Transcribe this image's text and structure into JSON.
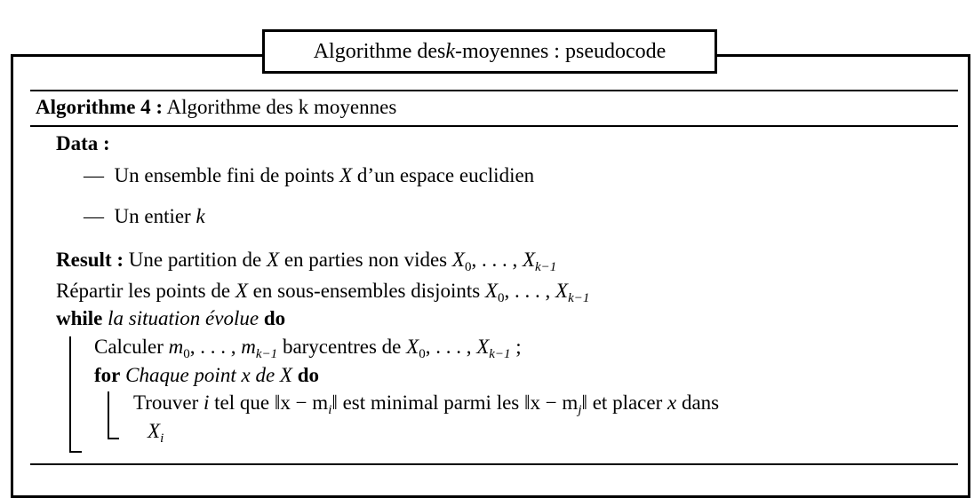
{
  "title": {
    "prefix": "Algorithme des ",
    "k": "k",
    "suffix": "-moyennes : pseudocode"
  },
  "algorithm": {
    "label": "Algorithme 4 :",
    "name": " Algorithme des k moyennes"
  },
  "data_section": {
    "label": "Data :",
    "items": [
      {
        "dash": "—",
        "text1": "Un ensemble fini de points ",
        "var": "X",
        "text2": " d’un espace euclidien"
      },
      {
        "dash": "—",
        "text1": "Un entier ",
        "var": "k",
        "text2": ""
      }
    ]
  },
  "result": {
    "label": "Result :",
    "text1": " Une partition de ",
    "var": "X",
    "text2": " en parties non vides ",
    "set": "X",
    "sub0": "0",
    "ellipsis": ", . . . , ",
    "subk": "k−1"
  },
  "step1": {
    "text1": "Répartir les points de ",
    "var": "X",
    "text2": " en sous-ensembles disjoints ",
    "set": "X",
    "sub0": "0",
    "ellipsis": ", . . . , ",
    "subk": "k−1"
  },
  "while_line": {
    "kw_while": "while",
    "condition": " la situation évolue ",
    "kw_do": "do"
  },
  "calc_line": {
    "text1": "Calculer ",
    "m": "m",
    "sub0": "0",
    "ellipsis": ", . . . , ",
    "subk": "k−1",
    "text2": " barycentres de ",
    "set": "X",
    "ellipsis2": ", . . . , ",
    "end": " ;"
  },
  "for_line": {
    "kw_for": "for",
    "cond1": " Chaque point ",
    "x": "x",
    "cond2": " de ",
    "X": "X",
    "kw_do": " do"
  },
  "inner_line1": {
    "text1": "Trouver ",
    "i": "i",
    "text2": " tel que ",
    "norm1": "‖x − m",
    "sub_i": "i",
    "norm1_end": "‖",
    "text3": " est minimal parmi les ",
    "norm2": "‖x − m",
    "sub_j": "j",
    "norm2_end": "‖",
    "text4": " et placer ",
    "x": "x",
    "text5": " dans"
  },
  "inner_line2": {
    "X": "X",
    "sub_i": "i"
  }
}
